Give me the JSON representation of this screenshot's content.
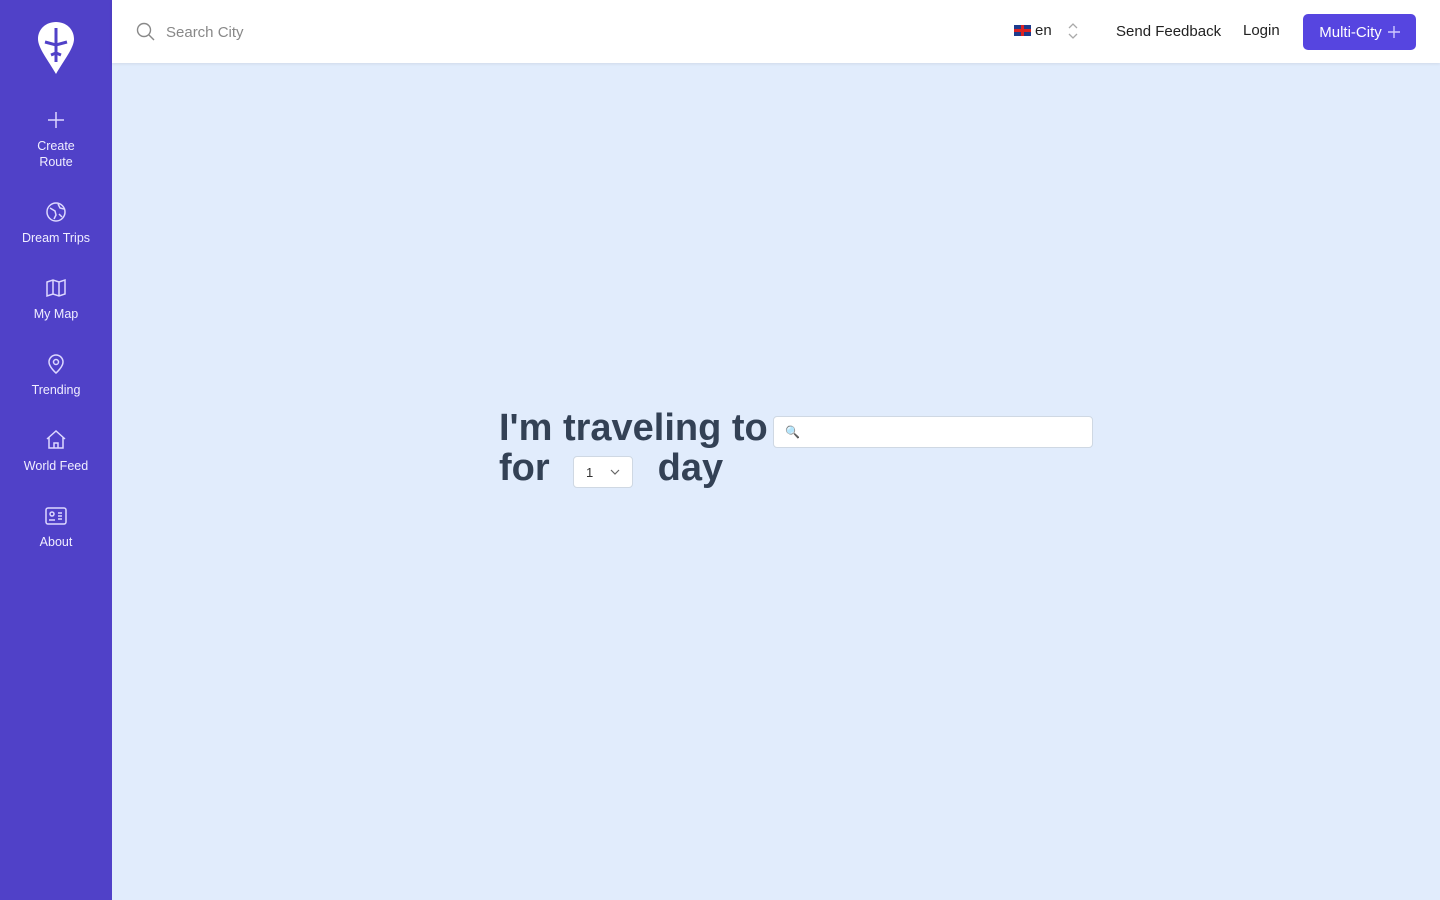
{
  "sidebar": {
    "items": [
      {
        "label": "Create Route",
        "icon": "plus-icon"
      },
      {
        "label": "Dream Trips",
        "icon": "globe-icon"
      },
      {
        "label": "My Map",
        "icon": "map-icon"
      },
      {
        "label": "Trending",
        "icon": "map-pin-icon"
      },
      {
        "label": "World Feed",
        "icon": "home-icon"
      },
      {
        "label": "About",
        "icon": "id-card-icon"
      }
    ]
  },
  "topbar": {
    "search_placeholder": "Search City",
    "language": "en",
    "feedback": "Send Feedback",
    "login": "Login",
    "multi_city": "Multi-City"
  },
  "hero": {
    "line1": "I'm traveling to",
    "for": "for",
    "day": "day",
    "days_value": "1",
    "destination_value": ""
  },
  "colors": {
    "sidebar": "#5041c8",
    "accent": "#5645e0",
    "background": "#e1ecfc"
  }
}
